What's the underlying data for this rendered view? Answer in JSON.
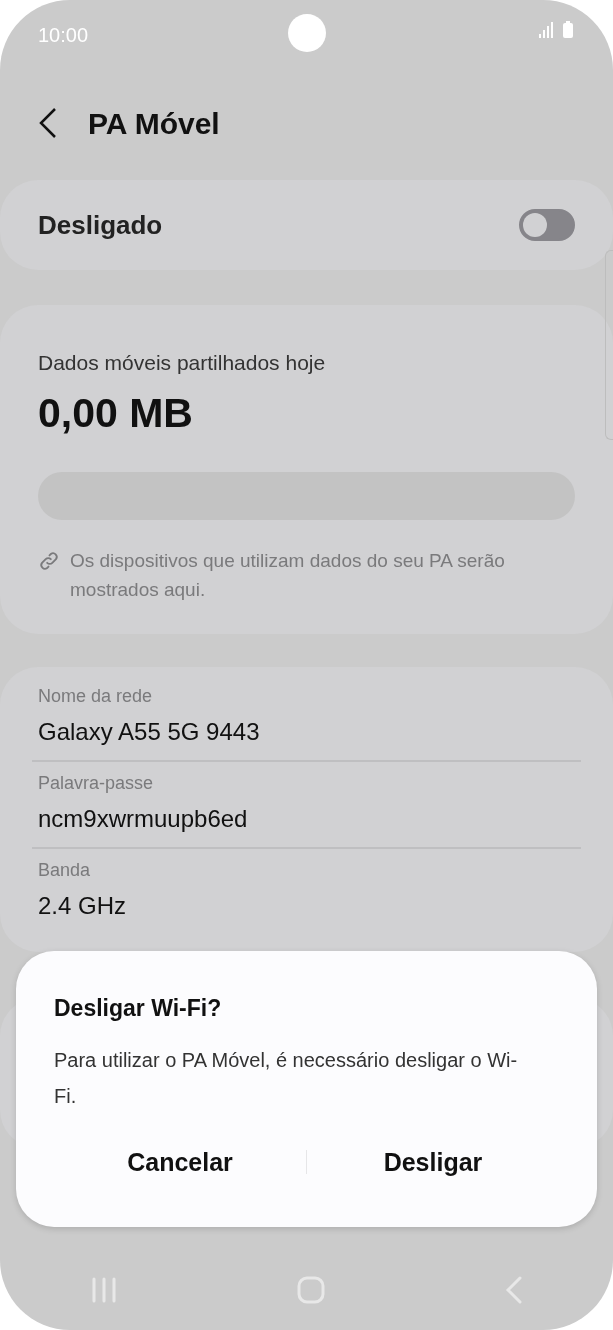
{
  "status_bar": {
    "time": "10:00"
  },
  "header": {
    "title": "PA Móvel"
  },
  "hotspot_switch": {
    "label": "Desligado",
    "on": false
  },
  "usage": {
    "title": "Dados móveis partilhados hoje",
    "amount": "0,00 MB",
    "note": "Os dispositivos que utilizam dados do seu PA serão mostrados aqui."
  },
  "settings": [
    {
      "label": "Nome da rede",
      "value": "Galaxy A55 5G 9443"
    },
    {
      "label": "Palavra-passe",
      "value": "ncm9xwrmuupb6ed"
    },
    {
      "label": "Banda",
      "value": "2.4 GHz"
    }
  ],
  "dialog": {
    "title": "Desligar Wi-Fi?",
    "message": "Para utilizar o PA Móvel, é necessário desligar o Wi-Fi.",
    "buttons": [
      "Cancelar",
      "Desligar"
    ]
  }
}
